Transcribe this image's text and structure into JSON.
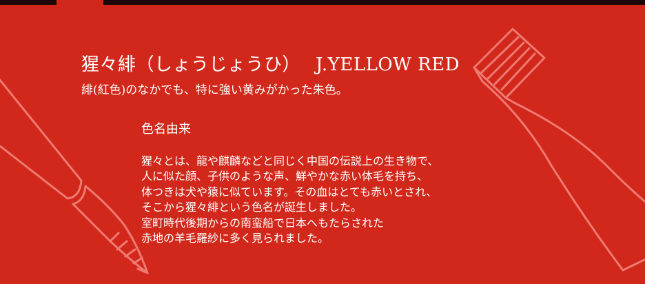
{
  "heading": {
    "title_ja": "猩々緋（しょうじょうひ）",
    "title_en": "J.YELLOW RED",
    "subtitle": "緋(紅色)のなかでも、特に強い黄みがかった朱色。"
  },
  "origin": {
    "heading": "色名由来",
    "lines": [
      "猩々とは、龍や麒麟などと同じく中国の伝説上の生き物で、",
      "人に似た顔、子供のような声、鮮やかな赤い体毛を持ち、",
      "体つきは犬や猿に似ています。その血はとても赤いとされ、",
      "そこから猩々緋という色名が誕生しました。",
      "室町時代後期からの南蛮船で日本へもたらされた",
      "赤地の羊毛羅紗に多く見られました。"
    ]
  },
  "colors": {
    "background": "#d2281b",
    "topbar": "#1c0706",
    "illustration_stroke": "#f07a72",
    "text": "#ffffff"
  },
  "illustrations": [
    "brush-illustration",
    "paint-tube-illustration"
  ]
}
